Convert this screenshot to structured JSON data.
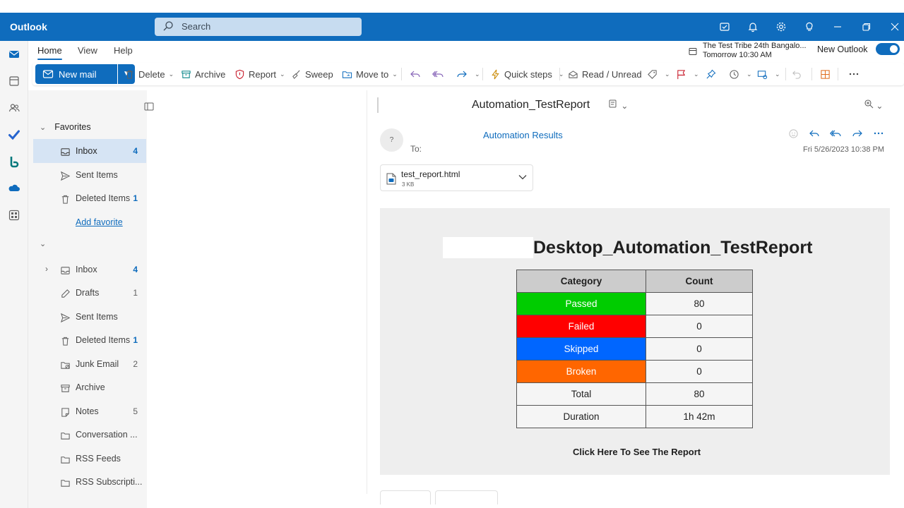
{
  "app": {
    "name": "Outlook"
  },
  "search": {
    "placeholder": "Search"
  },
  "ribbon_tabs": [
    "Home",
    "View",
    "Help"
  ],
  "upcoming_event": {
    "title": "The Test Tribe 24th Bangalo...",
    "time": "Tomorrow 10:30 AM"
  },
  "new_outlook": {
    "label": "New Outlook",
    "enabled": true
  },
  "toolbar": {
    "new_mail": "New mail",
    "delete": "Delete",
    "archive": "Archive",
    "report": "Report",
    "sweep": "Sweep",
    "move_to": "Move to",
    "quick_steps": "Quick steps",
    "read_unread": "Read / Unread"
  },
  "favorites": {
    "header": "Favorites",
    "items": [
      {
        "name": "Inbox",
        "count": "4"
      },
      {
        "name": "Sent Items",
        "count": ""
      },
      {
        "name": "Deleted Items",
        "count": "1"
      }
    ],
    "add_favorite": "Add favorite"
  },
  "folders": [
    {
      "name": "Inbox",
      "count": "4"
    },
    {
      "name": "Drafts",
      "count": "1"
    },
    {
      "name": "Sent Items",
      "count": ""
    },
    {
      "name": "Deleted Items",
      "count": "1"
    },
    {
      "name": "Junk Email",
      "count": "2"
    },
    {
      "name": "Archive",
      "count": ""
    },
    {
      "name": "Notes",
      "count": "5"
    },
    {
      "name": "Conversation ...",
      "count": ""
    },
    {
      "name": "RSS Feeds",
      "count": ""
    },
    {
      "name": "RSS Subscripti...",
      "count": ""
    }
  ],
  "message": {
    "subject": "Automation_TestReport",
    "sender": "Automation Results",
    "avatar": "?",
    "to_label": "To:",
    "date": "Fri 5/26/2023 10:38 PM",
    "attachment": {
      "name": "test_report.html",
      "size": "3 KB"
    }
  },
  "report": {
    "title": "Desktop_Automation_TestReport",
    "headers": {
      "category": "Category",
      "count": "Count"
    },
    "rows": [
      {
        "category": "Passed",
        "count": "80",
        "color": "#00cc00"
      },
      {
        "category": "Failed",
        "count": "0",
        "color": "#ff0000"
      },
      {
        "category": "Skipped",
        "count": "0",
        "color": "#0066ff"
      },
      {
        "category": "Broken",
        "count": "0",
        "color": "#ff6600"
      },
      {
        "category": "Total",
        "count": "80",
        "color": ""
      },
      {
        "category": "Duration",
        "count": "1h 42m",
        "color": ""
      }
    ],
    "link": "Click Here To See The Report"
  },
  "colors": {
    "brand": "#0f6cbd",
    "selected_folder": "#d6e4f4"
  }
}
